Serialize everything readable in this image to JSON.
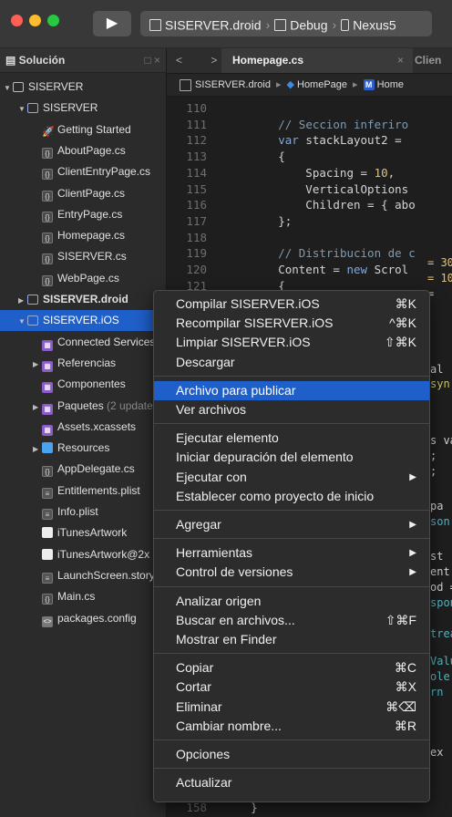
{
  "toolbar": {
    "colors": {
      "close": "#fe5f57",
      "minimize": "#febc2e",
      "zoom": "#28c840"
    },
    "run_icon": "play-icon",
    "run_glyph": "▶",
    "scheme_parts": [
      "SISERVER.droid",
      "Debug",
      "Nexus5"
    ]
  },
  "solution_pad": {
    "title": "Solución",
    "close_glyph": "□ ×",
    "tree": [
      {
        "label": "SISERVER",
        "depth": 0,
        "arrow": "▼",
        "icon": "solution"
      },
      {
        "label": "SISERVER",
        "depth": 1,
        "arrow": "▼",
        "icon": "project"
      },
      {
        "label": "Getting Started",
        "depth": 2,
        "arrow": "",
        "icon": "rocket"
      },
      {
        "label": "AboutPage.cs",
        "depth": 2,
        "arrow": "",
        "icon": "cs"
      },
      {
        "label": "ClientEntryPage.cs",
        "depth": 2,
        "arrow": "",
        "icon": "cs"
      },
      {
        "label": "ClientPage.cs",
        "depth": 2,
        "arrow": "",
        "icon": "cs"
      },
      {
        "label": "EntryPage.cs",
        "depth": 2,
        "arrow": "",
        "icon": "cs"
      },
      {
        "label": "Homepage.cs",
        "depth": 2,
        "arrow": "",
        "icon": "cs"
      },
      {
        "label": "SISERVER.cs",
        "depth": 2,
        "arrow": "",
        "icon": "cs"
      },
      {
        "label": "WebPage.cs",
        "depth": 2,
        "arrow": "",
        "icon": "cs"
      },
      {
        "label": "SISERVER.droid",
        "depth": 1,
        "arrow": "▶",
        "icon": "project",
        "bold": true
      },
      {
        "label": "SISERVER.iOS",
        "depth": 1,
        "arrow": "▼",
        "icon": "project",
        "selected": true
      },
      {
        "label": "Connected Services",
        "depth": 2,
        "arrow": "",
        "icon": "purple"
      },
      {
        "label": "Referencias",
        "depth": 2,
        "arrow": "▶",
        "icon": "purple"
      },
      {
        "label": "Componentes",
        "depth": 2,
        "arrow": "",
        "icon": "purple"
      },
      {
        "label": "Paquetes",
        "extra": "(2 updates)",
        "depth": 2,
        "arrow": "▶",
        "icon": "purple"
      },
      {
        "label": "Assets.xcassets",
        "depth": 2,
        "arrow": "",
        "icon": "purple"
      },
      {
        "label": "Resources",
        "depth": 2,
        "arrow": "▶",
        "icon": "folder"
      },
      {
        "label": "AppDelegate.cs",
        "depth": 2,
        "arrow": "",
        "icon": "cs"
      },
      {
        "label": "Entitlements.plist",
        "depth": 2,
        "arrow": "",
        "icon": "plist"
      },
      {
        "label": "Info.plist",
        "depth": 2,
        "arrow": "",
        "icon": "plist"
      },
      {
        "label": "iTunesArtwork",
        "depth": 2,
        "arrow": "",
        "icon": "white"
      },
      {
        "label": "iTunesArtwork@2x",
        "depth": 2,
        "arrow": "",
        "icon": "white"
      },
      {
        "label": "LaunchScreen.storyboard",
        "depth": 2,
        "arrow": "",
        "icon": "plist"
      },
      {
        "label": "Main.cs",
        "depth": 2,
        "arrow": "",
        "icon": "cs"
      },
      {
        "label": "packages.config",
        "depth": 2,
        "arrow": "",
        "icon": "xml"
      }
    ]
  },
  "editor": {
    "nav_glyphs": "< >",
    "tab_label": "Homepage.cs",
    "tab_close": "×",
    "tab2_label": "Clien",
    "breadcrumbs": {
      "project": "SISERVER.droid",
      "cls": "HomePage",
      "member": "Home",
      "sep": "▸"
    },
    "code_lines": [
      {
        "n": "110",
        "parts": []
      },
      {
        "n": "111",
        "parts": [
          {
            "t": "        "
          },
          {
            "t": "// Seccion inferiro",
            "c": "cmt"
          }
        ]
      },
      {
        "n": "112",
        "parts": [
          {
            "t": "        "
          },
          {
            "t": "var",
            "c": "kw"
          },
          {
            "t": " stackLayout2 = "
          }
        ]
      },
      {
        "n": "113",
        "parts": [
          {
            "t": "        {"
          }
        ]
      },
      {
        "n": "114",
        "parts": [
          {
            "t": "            Spacing = "
          },
          {
            "t": "10",
            "c": "num"
          },
          {
            "t": ","
          }
        ]
      },
      {
        "n": "115",
        "parts": [
          {
            "t": "            VerticalOptions"
          }
        ]
      },
      {
        "n": "116",
        "parts": [
          {
            "t": "            Children = { abo"
          }
        ]
      },
      {
        "n": "117",
        "parts": [
          {
            "t": "        };"
          }
        ]
      },
      {
        "n": "118",
        "parts": []
      },
      {
        "n": "119",
        "parts": [
          {
            "t": "        "
          },
          {
            "t": "// Distribucion de c",
            "c": "cmt"
          }
        ]
      },
      {
        "n": "120",
        "parts": [
          {
            "t": "        Content = "
          },
          {
            "t": "new",
            "c": "kw"
          },
          {
            "t": " Scrol"
          }
        ]
      },
      {
        "n": "121",
        "parts": [
          {
            "t": "        {"
          }
        ]
      },
      {
        "n": "122",
        "parts": [
          {
            "t": "            Content = "
          },
          {
            "t": "new",
            "c": "kw"
          },
          {
            "t": " S"
          }
        ]
      }
    ],
    "fragments": [
      {
        "t": "= 30",
        "cls": "num"
      },
      {
        "t": "= 10",
        "cls": "num"
      },
      {
        "t": "=",
        "cls": ""
      },
      {
        "t": "al",
        "cls": ""
      },
      {
        "t": "syn",
        "cls": "y"
      },
      {
        "t": "s va",
        "cls": ""
      },
      {
        "t": ";",
        "cls": ""
      },
      {
        "t": ";",
        "cls": ""
      },
      {
        "t": "pa",
        "cls": ""
      },
      {
        "t": "son",
        "cls": "c"
      },
      {
        "t": "st",
        "cls": ""
      },
      {
        "t": "ent",
        "cls": ""
      },
      {
        "t": "od =",
        "cls": ""
      },
      {
        "t": "spon",
        "cls": "c"
      },
      {
        "t": "trea",
        "cls": "c"
      },
      {
        "t": "Valu",
        "cls": "c"
      },
      {
        "t": "ole",
        "cls": "c"
      },
      {
        "t": "rn",
        "cls": "c"
      },
      {
        "t": "ex",
        "cls": ""
      }
    ],
    "last_line": {
      "n": "158",
      "t": "    }"
    }
  },
  "context_menu": {
    "items": [
      {
        "label": "Compilar SISERVER.iOS",
        "shortcut": "⌘K"
      },
      {
        "label": "Recompilar SISERVER.iOS",
        "shortcut": "^⌘K"
      },
      {
        "label": "Limpiar SISERVER.iOS",
        "shortcut": "⇧⌘K"
      },
      {
        "label": "Descargar",
        "shortcut": ""
      },
      {
        "sep": true
      },
      {
        "label": "Archivo para publicar",
        "shortcut": "",
        "highlighted": true
      },
      {
        "label": "Ver archivos",
        "shortcut": ""
      },
      {
        "sep": true
      },
      {
        "label": "Ejecutar elemento",
        "shortcut": ""
      },
      {
        "label": "Iniciar depuración del elemento",
        "shortcut": ""
      },
      {
        "label": "Ejecutar con",
        "shortcut": "",
        "submenu": true
      },
      {
        "label": "Establecer como proyecto de inicio",
        "shortcut": ""
      },
      {
        "sep": true
      },
      {
        "label": "Agregar",
        "shortcut": "",
        "submenu": true
      },
      {
        "sep": true
      },
      {
        "label": "Herramientas",
        "shortcut": "",
        "submenu": true
      },
      {
        "label": "Control de versiones",
        "shortcut": "",
        "submenu": true
      },
      {
        "sep": true
      },
      {
        "label": "Analizar origen",
        "shortcut": ""
      },
      {
        "label": "Buscar en archivos...",
        "shortcut": "⇧⌘F"
      },
      {
        "label": "Mostrar en Finder",
        "shortcut": ""
      },
      {
        "sep": true
      },
      {
        "label": "Copiar",
        "shortcut": "⌘C"
      },
      {
        "label": "Cortar",
        "shortcut": "⌘X"
      },
      {
        "label": "Eliminar",
        "shortcut": "⌘⌫"
      },
      {
        "label": "Cambiar nombre...",
        "shortcut": "⌘R"
      },
      {
        "sep": true
      },
      {
        "label": "Opciones",
        "shortcut": ""
      },
      {
        "sep": true
      },
      {
        "label": "Actualizar",
        "shortcut": ""
      }
    ],
    "submenu_glyph": "▶"
  }
}
